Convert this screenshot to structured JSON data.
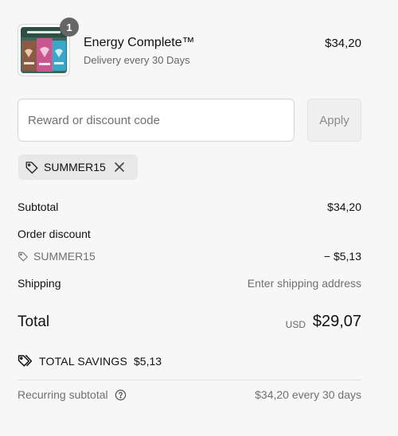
{
  "line_item": {
    "quantity": "1",
    "name": "Energy Complete™",
    "delivery": "Delivery every 30 Days",
    "price": "$34,20",
    "image_icon": "product-bundle-image"
  },
  "discount": {
    "placeholder": "Reward or discount code",
    "value": "",
    "apply_label": "Apply",
    "applied_code": "SUMMER15"
  },
  "summary": {
    "subtotal_label": "Subtotal",
    "subtotal_value": "$34,20",
    "order_discount_label": "Order discount",
    "discount_code": "SUMMER15",
    "discount_value": "− $5,13",
    "shipping_label": "Shipping",
    "shipping_value": "Enter shipping address",
    "total_label": "Total",
    "currency": "USD",
    "total_value": "$29,07",
    "savings_label": "TOTAL SAVINGS",
    "savings_value": "$5,13",
    "recurring_label": "Recurring subtotal",
    "recurring_value": "$34,20 every 30 days"
  },
  "colors": {
    "background": "#f7f7f7",
    "text": "#111111",
    "muted": "#707070",
    "chip": "#e8e8e8",
    "badge": "#666666"
  }
}
